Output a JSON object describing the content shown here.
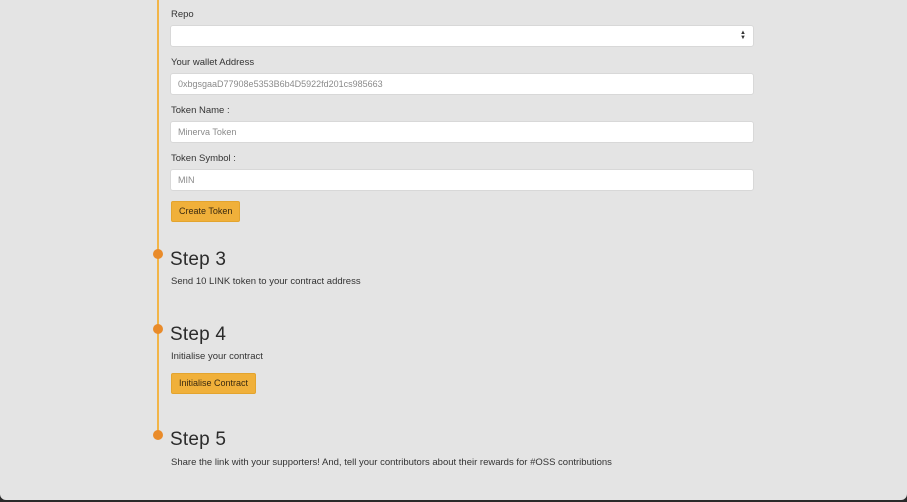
{
  "form": {
    "repo_label": "Repo",
    "repo_value": "",
    "wallet_label": "Your wallet Address",
    "wallet_value": "0xbgsgaaD77908e5353B6b4D5922fd201cs985663",
    "token_name_label": "Token Name :",
    "token_name_placeholder": "Minerva Token",
    "token_symbol_label": "Token Symbol :",
    "token_symbol_placeholder": "MIN",
    "create_button": "Create Token"
  },
  "steps": [
    {
      "title": "Step 3",
      "description": "Send 10 LINK token to your contract address"
    },
    {
      "title": "Step 4",
      "description": "Initialise your contract",
      "button": "Initialise Contract"
    },
    {
      "title": "Step 5",
      "description": "Share the link with your supporters! And, tell your contributors about their rewards for #OSS contributions"
    }
  ],
  "colors": {
    "accent": "#f0b03a",
    "timeline": "#f2b548",
    "dot": "#e98b2a",
    "background": "#e4e4e4"
  },
  "icons": {
    "select_caret": "updown-caret-icon"
  }
}
